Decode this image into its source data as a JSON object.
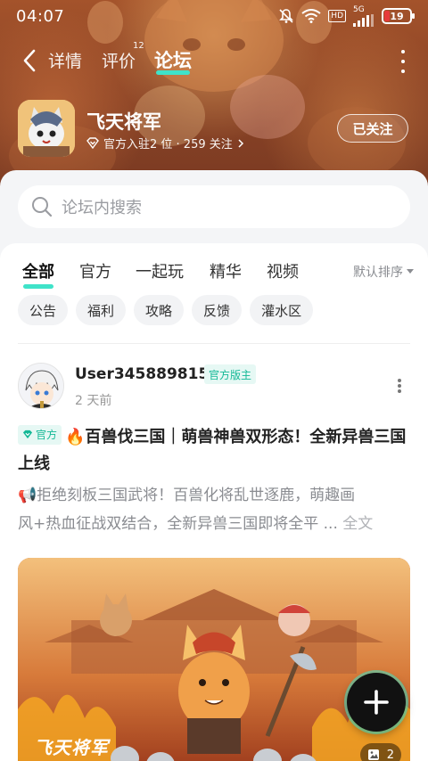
{
  "status_bar": {
    "time": "04:07",
    "hd_label": "HD",
    "network_label": "5G",
    "battery_level": "19"
  },
  "nav": {
    "tabs": [
      {
        "label": "详情"
      },
      {
        "label": "评价",
        "badge": "12"
      },
      {
        "label": "论坛",
        "active": true
      }
    ]
  },
  "game": {
    "name": "飞天将军",
    "meta": "官方入驻2 位 · 259 关注",
    "follow_label": "已关注"
  },
  "search": {
    "placeholder": "论坛内搜索"
  },
  "filter_tabs": {
    "items": [
      {
        "label": "全部",
        "active": true
      },
      {
        "label": "官方"
      },
      {
        "label": "一起玩"
      },
      {
        "label": "精华"
      },
      {
        "label": "视频"
      }
    ],
    "sort_label": "默认排序"
  },
  "chips": [
    {
      "label": "公告"
    },
    {
      "label": "福利"
    },
    {
      "label": "攻略"
    },
    {
      "label": "反馈"
    },
    {
      "label": "灌水区"
    }
  ],
  "post": {
    "username": "User345889815",
    "author_badge": "官方版主",
    "time": "2 天前",
    "title_tag": "官方",
    "title": "🔥百兽伐三国｜萌兽神兽双形态！全新异兽三国上线",
    "excerpt_line1": "📢拒绝刻板三国武将！百兽化将乱世逐鹿，萌趣画",
    "excerpt_line2": "风+热血征战双结合，全新异兽三国即将全平 ...",
    "read_more": "全文",
    "image_watermark": "飞天将军",
    "image_count": "2"
  },
  "colors": {
    "accent": "#3fe3c9",
    "official_green": "#14b896",
    "banner_brown": "#8c4426",
    "battery_low": "#e63b3b"
  }
}
